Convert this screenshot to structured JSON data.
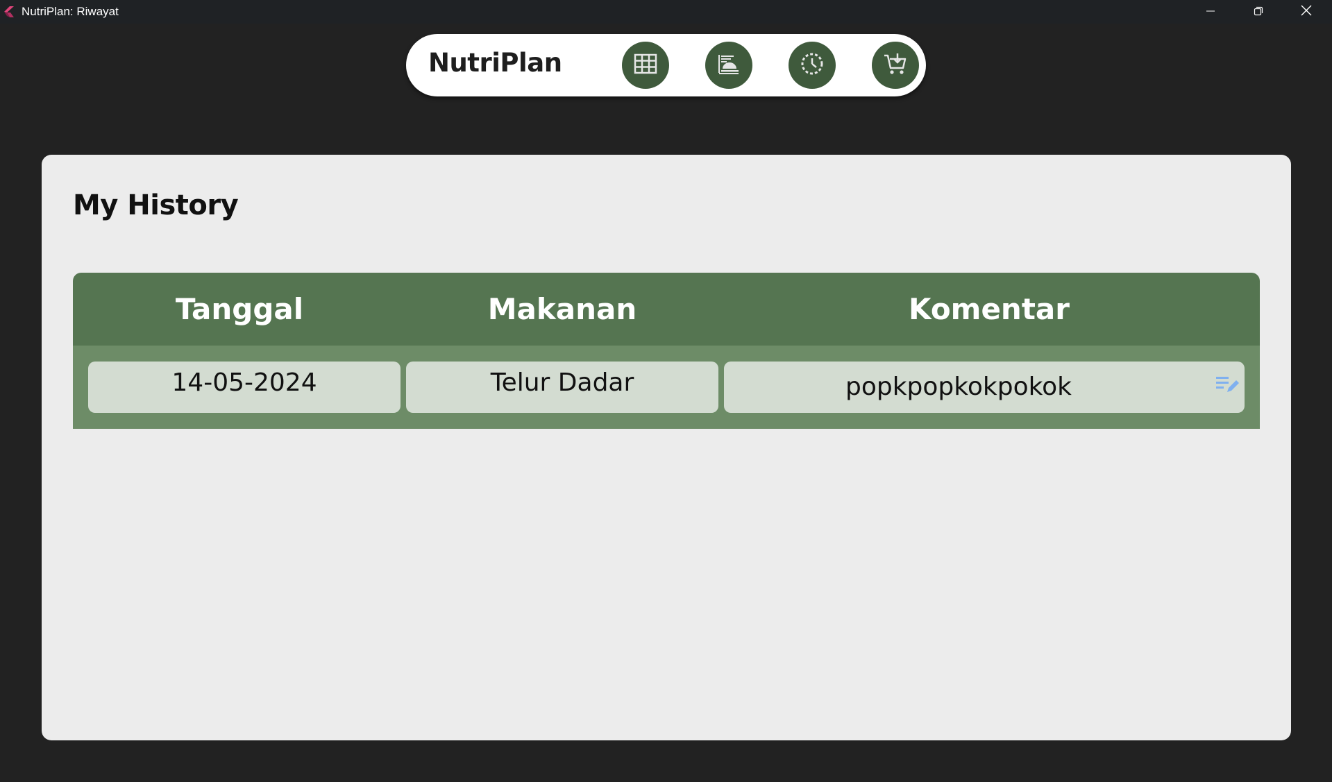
{
  "window": {
    "title": "NutriPlan: Riwayat",
    "app_icon": "flutter-logo-icon",
    "controls": [
      "minimize-icon",
      "maximize-icon",
      "close-icon"
    ]
  },
  "navbar": {
    "brand": "NutriPlan",
    "buttons": [
      {
        "icon": "grid-icon"
      },
      {
        "icon": "food-tray-icon"
      },
      {
        "icon": "history-clock-icon"
      },
      {
        "icon": "shopping-cart-icon"
      }
    ],
    "button_color": "#3f5a3c"
  },
  "page": {
    "title": "My History"
  },
  "table": {
    "headers": [
      "Tanggal",
      "Makanan",
      "Komentar"
    ],
    "rows": [
      {
        "tanggal": "14-05-2024",
        "makanan": "Telur Dadar",
        "komentar": "popkpopkokpokok"
      }
    ],
    "edit_icon": "edit-note-icon",
    "header_color": "#557551",
    "row_color": "#6d8c67",
    "cell_color": "#d3dcd1"
  },
  "colors": {
    "background": "#222222",
    "card": "#ececec",
    "edit_icon": "#7fb0ef"
  }
}
